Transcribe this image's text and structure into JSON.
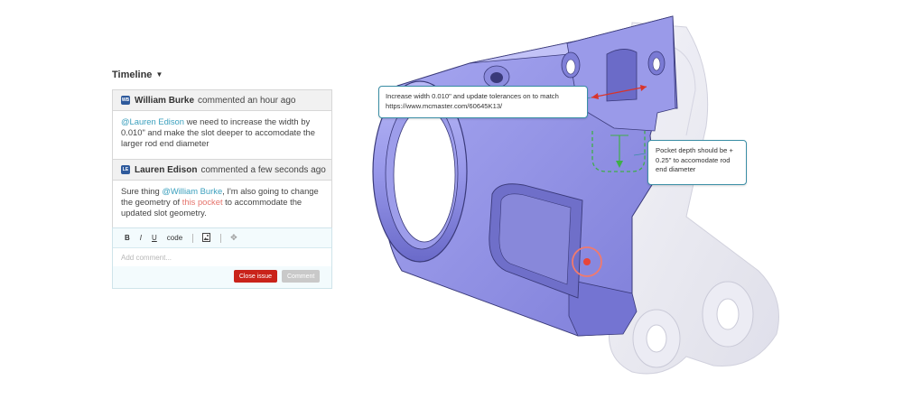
{
  "timeline": {
    "title": "Timeline",
    "comments": [
      {
        "avatar": "WB",
        "author": "William Burke",
        "meta": "commented an hour ago",
        "mention": "@Lauren Edison",
        "text": " we need to increase the width by 0.010\" and make the slot deeper to accomodate the larger rod end diameter"
      },
      {
        "avatar": "LE",
        "author": "Lauren Edison",
        "meta": "commented a few seconds ago",
        "text_before": "Sure thing ",
        "mention": "@William Burke",
        "text_middle": ", I'm also going to change the geometry of ",
        "ref": "this pocket",
        "text_after": " to accommodate the updated slot geometry."
      }
    ]
  },
  "editor": {
    "toolbar": {
      "bold": "B",
      "italic": "I",
      "underline": "U",
      "code": "code"
    },
    "icons": {
      "image": "image-icon",
      "move": "move-icon"
    },
    "placeholder": "Add comment...",
    "close_label": "Close issue",
    "comment_label": "Comment"
  },
  "annotations": {
    "width_note": "Increase width 0.010\" and update tolerances on to match https://www.mcmaster.com/60645K13/",
    "pocket_note": "Pocket depth should be + 0.25\" to accomodate rod end diameter"
  },
  "colors": {
    "accent": "#3a9fbd",
    "danger": "#c9231a",
    "reference": "#e5736c",
    "dimension_red": "#d8342b",
    "dimension_green": "#3fae49",
    "part_purple": "#8f8fe6"
  }
}
